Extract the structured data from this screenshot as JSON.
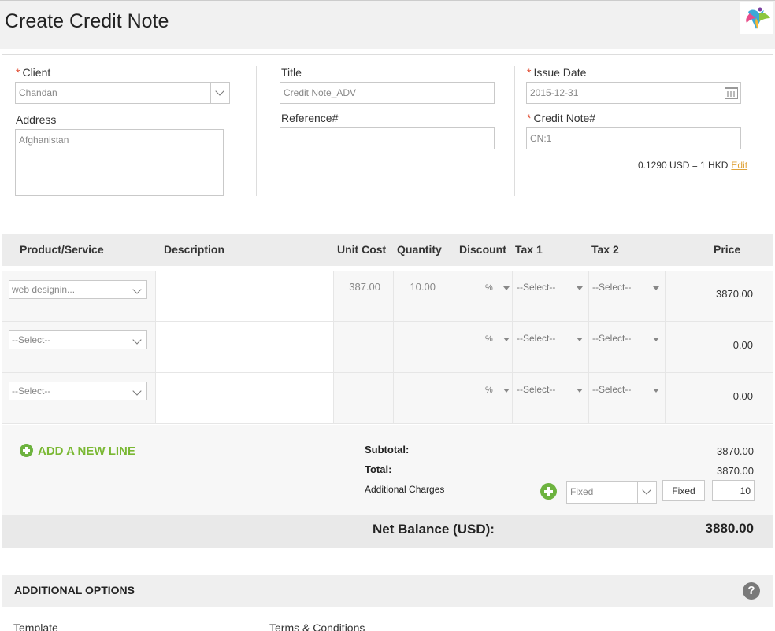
{
  "page": {
    "title": "Create Credit Note"
  },
  "form": {
    "client": {
      "label": "Client",
      "value": "Chandan"
    },
    "address": {
      "label": "Address",
      "value": "Afghanistan"
    },
    "title": {
      "label": "Title",
      "value": "Credit Note_ADV"
    },
    "reference": {
      "label": "Reference#",
      "value": ""
    },
    "issue_date": {
      "label": "Issue Date",
      "value": "2015-12-31"
    },
    "credit_note_no": {
      "label": "Credit Note#",
      "value": "CN:1"
    },
    "required_marker": "*",
    "exchange_rate": {
      "text": "0.1290 USD = 1 HKD",
      "edit_label": "Edit",
      "edit_color": "#e0a43c"
    }
  },
  "table": {
    "headers": [
      "Product/Service",
      "Description",
      "Unit Cost",
      "Quantity",
      "Discount",
      "Tax 1",
      "Tax 2",
      "Price"
    ],
    "rows": [
      {
        "product": "web designin...",
        "description": "",
        "unit_cost": "387.00",
        "quantity": "10.00",
        "discount_unit": "%",
        "tax1": "--Select--",
        "tax2": "--Select--",
        "price": "3870.00"
      },
      {
        "product": "--Select--",
        "description": "",
        "unit_cost": "",
        "quantity": "",
        "discount_unit": "%",
        "tax1": "--Select--",
        "tax2": "--Select--",
        "price": "0.00"
      },
      {
        "product": "--Select--",
        "description": "",
        "unit_cost": "",
        "quantity": "",
        "discount_unit": "%",
        "tax1": "--Select--",
        "tax2": "--Select--",
        "price": "0.00"
      }
    ]
  },
  "summary": {
    "add_line_label": "ADD A NEW LINE",
    "subtotal_label": "Subtotal:",
    "subtotal_value": "3870.00",
    "total_label": "Total:",
    "total_value": "3870.00",
    "additional_charges_label": "Additional Charges",
    "charge_type": "Fixed",
    "charge_mode_button": "Fixed",
    "charge_amount": "10",
    "accent_color": "#6db33f"
  },
  "net_balance": {
    "label": "Net Balance (USD):",
    "value": "3880.00"
  },
  "options": {
    "title": "ADDITIONAL OPTIONS",
    "help_icon": "?",
    "template_label": "Template",
    "terms_label": "Terms & Conditions"
  },
  "icons": [
    "logo-icon",
    "chevron-down-icon",
    "calendar-icon",
    "triangle-down-icon",
    "plus-circle-icon",
    "help-icon"
  ]
}
